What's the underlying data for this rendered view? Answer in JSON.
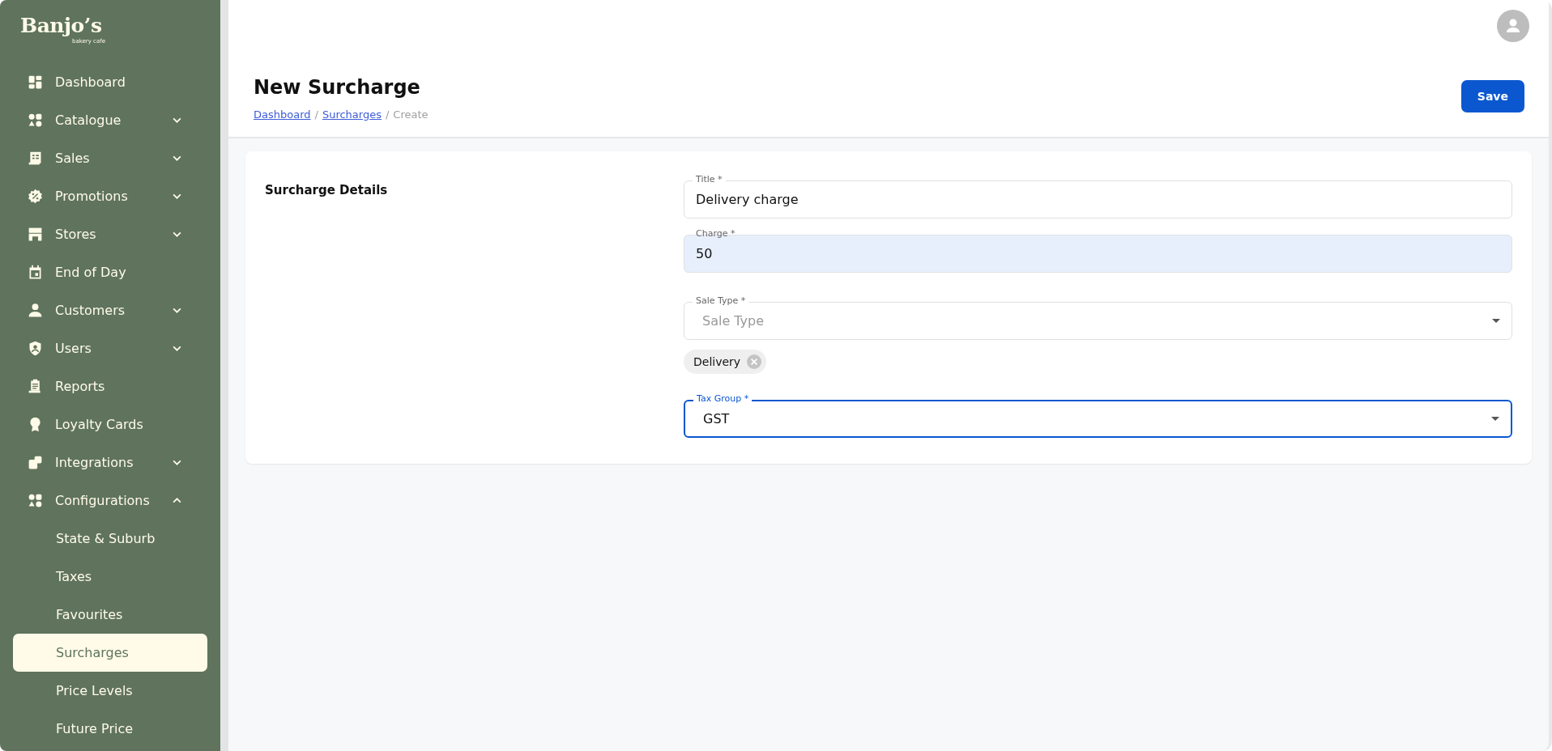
{
  "sidebar": {
    "logo": {
      "name": "Banjo’s",
      "tagline": "bakery cafe"
    },
    "items": [
      {
        "label": "Dashboard",
        "selected": false
      },
      {
        "label": "Catalogue",
        "selected": false,
        "expanded": false
      },
      {
        "label": "Sales",
        "selected": false,
        "expanded": false
      },
      {
        "label": "Promotions",
        "selected": false,
        "expanded": false
      },
      {
        "label": "Stores",
        "selected": false,
        "expanded": false
      },
      {
        "label": "End of Day",
        "selected": false
      },
      {
        "label": "Customers",
        "selected": false,
        "expanded": false
      },
      {
        "label": "Users",
        "selected": false,
        "expanded": false
      },
      {
        "label": "Reports",
        "selected": false
      },
      {
        "label": "Loyalty Cards",
        "selected": false
      },
      {
        "label": "Integrations",
        "selected": false,
        "expanded": false
      },
      {
        "label": "Configurations",
        "selected": false,
        "expanded": true,
        "children": [
          {
            "label": "State & Suburb",
            "selected": false
          },
          {
            "label": "Taxes",
            "selected": false
          },
          {
            "label": "Favourites",
            "selected": false
          },
          {
            "label": "Surcharges",
            "selected": true
          },
          {
            "label": "Price Levels",
            "selected": false
          },
          {
            "label": "Future Price",
            "selected": false
          }
        ]
      }
    ]
  },
  "header": {
    "title": "New Surcharge",
    "breadcrumb": [
      {
        "label": "Dashboard",
        "kind": "link"
      },
      {
        "label": "Surcharges",
        "kind": "link"
      },
      {
        "label": "Create",
        "kind": "current"
      }
    ],
    "separator": "/",
    "save_button": "Save"
  },
  "card": {
    "section_title": "Surcharge Details",
    "fields": [
      {
        "kind": "text",
        "label": "Title *",
        "value": "Delivery charge",
        "focused": false,
        "highlighted": false
      },
      {
        "kind": "text",
        "label": "Charge *",
        "value": "50",
        "focused": false,
        "highlighted": true
      },
      {
        "kind": "select",
        "label": "Sale Type *",
        "placeholder": "Sale Type",
        "focused": false,
        "highlighted": false,
        "chips": [
          "Delivery"
        ]
      },
      {
        "kind": "select",
        "label": "Tax Group *",
        "value": "GST",
        "focused": true,
        "highlighted": false
      }
    ]
  }
}
